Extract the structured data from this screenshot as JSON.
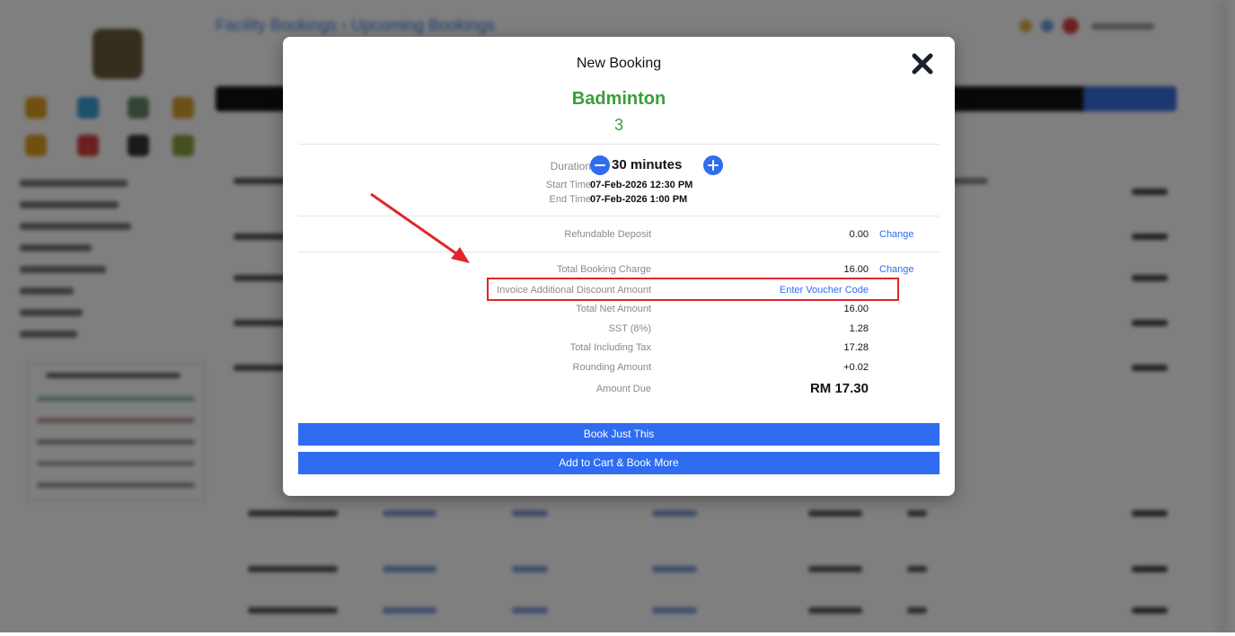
{
  "modal": {
    "title": "New Booking",
    "sport": "Badminton",
    "court": "3",
    "duration_label": "Duration",
    "duration_value": "30 minutes",
    "start_label": "Start Time",
    "start_value": "07-Feb-2026 12:30 PM",
    "end_label": "End Time",
    "end_value": "07-Feb-2026 1:00 PM",
    "deposit_label": "Refundable Deposit",
    "deposit_value": "0.00",
    "booking_charge_label": "Total Booking Charge",
    "booking_charge_value": "16.00",
    "change_label": "Change",
    "discount_label": "Invoice Additional Discount Amount",
    "voucher_link": "Enter Voucher Code",
    "net_label": "Total Net Amount",
    "net_value": "16.00",
    "sst_label": "SST (8%)",
    "sst_value": "1.28",
    "incl_tax_label": "Total Including Tax",
    "incl_tax_value": "17.28",
    "rounding_label": "Rounding Amount",
    "rounding_value": "+0.02",
    "due_label": "Amount Due",
    "due_value": "RM 17.30",
    "book_button": "Book Just This",
    "cart_button": "Add to Cart & Book More"
  },
  "background": {
    "breadcrumb": "Facility Bookings  ›  Upcoming Bookings"
  },
  "icons": {
    "close": "close-icon",
    "minus": "minus-circle-icon",
    "plus": "plus-circle-icon"
  },
  "colors": {
    "accent": "#2f6cf0",
    "sport_green": "#3a9e3a",
    "highlight_red": "#e0262a"
  }
}
